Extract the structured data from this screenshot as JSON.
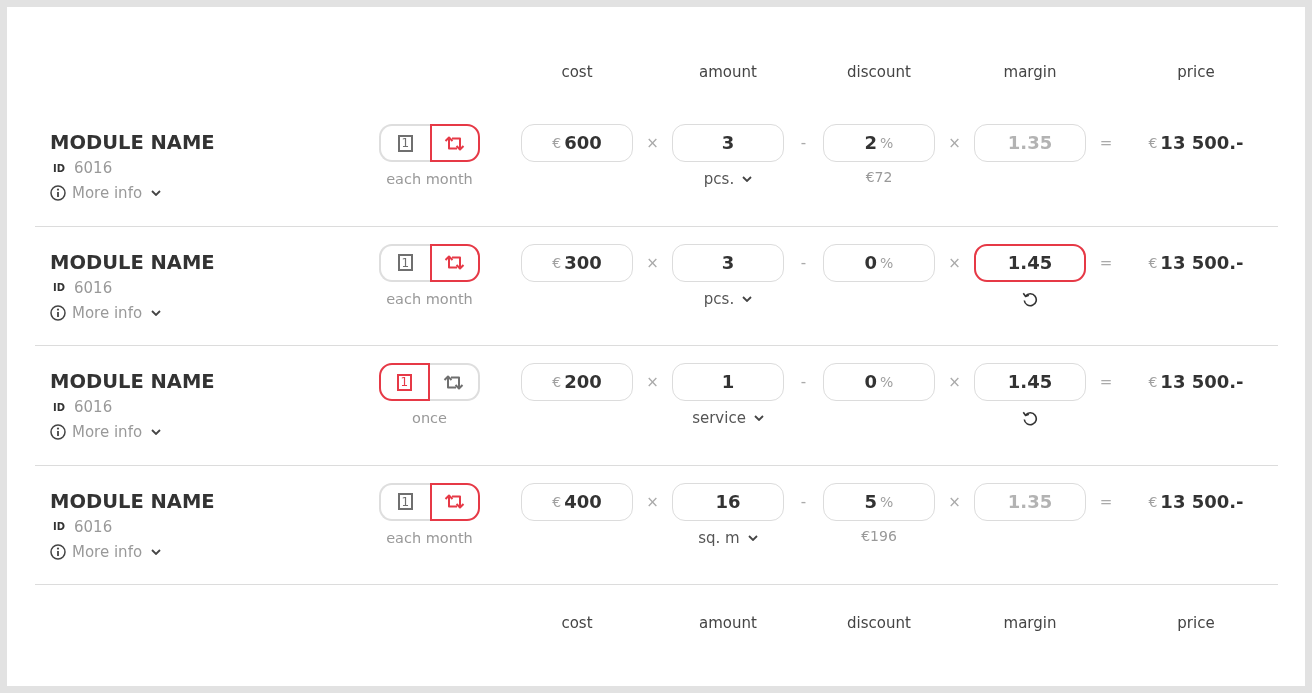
{
  "header": {
    "columns": [
      "cost",
      "amount",
      "discount",
      "margin",
      "price"
    ]
  },
  "rows": [
    {
      "name": "MODULE NAME",
      "id_label": "ID",
      "id": "6016",
      "more_info": "More info",
      "frequency": {
        "options": [
          {
            "kind": "once",
            "glyph": "1",
            "selected": false
          },
          {
            "kind": "repeat",
            "selected": true
          }
        ],
        "label": "each month"
      },
      "cost": {
        "currency": "€",
        "value": "600"
      },
      "operators": [
        "×",
        "-",
        "×",
        "="
      ],
      "amount": {
        "value": "3",
        "unit": "pcs."
      },
      "discount": {
        "value": "2",
        "suffix": "%",
        "note": "€72"
      },
      "margin": {
        "placeholder": "1.35",
        "focused": false,
        "resettable": false
      },
      "price": {
        "currency": "€",
        "value": "13 500.-"
      }
    },
    {
      "name": "MODULE NAME",
      "id_label": "ID",
      "id": "6016",
      "more_info": "More info",
      "frequency": {
        "options": [
          {
            "kind": "once",
            "glyph": "1",
            "selected": false
          },
          {
            "kind": "repeat",
            "selected": true
          }
        ],
        "label": "each month"
      },
      "cost": {
        "currency": "€",
        "value": "300"
      },
      "operators": [
        "×",
        "-",
        "×",
        "="
      ],
      "amount": {
        "value": "3",
        "unit": "pcs."
      },
      "discount": {
        "value": "0",
        "suffix": "%"
      },
      "margin": {
        "value": "1.45",
        "focused": true,
        "resettable": true
      },
      "price": {
        "currency": "€",
        "value": "13 500.-"
      }
    },
    {
      "name": "MODULE NAME",
      "id_label": "ID",
      "id": "6016",
      "more_info": "More info",
      "frequency": {
        "options": [
          {
            "kind": "once",
            "glyph": "1",
            "selected": true
          },
          {
            "kind": "repeat",
            "selected": false
          }
        ],
        "label": "once"
      },
      "cost": {
        "currency": "€",
        "value": "200"
      },
      "operators": [
        "×",
        "-",
        "×",
        "="
      ],
      "amount": {
        "value": "1",
        "unit": "service"
      },
      "discount": {
        "value": "0",
        "suffix": "%"
      },
      "margin": {
        "value": "1.45",
        "focused": false,
        "resettable": true
      },
      "price": {
        "currency": "€",
        "value": "13 500.-"
      }
    },
    {
      "name": "MODULE NAME",
      "id_label": "ID",
      "id": "6016",
      "more_info": "More info",
      "frequency": {
        "options": [
          {
            "kind": "once",
            "glyph": "1",
            "selected": false
          },
          {
            "kind": "repeat",
            "selected": true
          }
        ],
        "label": "each month"
      },
      "cost": {
        "currency": "€",
        "value": "400"
      },
      "operators": [
        "×",
        "-",
        "×",
        "="
      ],
      "amount": {
        "value": "16",
        "unit": "sq. m"
      },
      "discount": {
        "value": "5",
        "suffix": "%",
        "note": "€196"
      },
      "margin": {
        "placeholder": "1.35",
        "focused": false,
        "resettable": false
      },
      "price": {
        "currency": "€",
        "value": "13 500.-"
      }
    }
  ],
  "footer": {
    "columns": [
      "cost",
      "amount",
      "discount",
      "margin",
      "price"
    ]
  }
}
